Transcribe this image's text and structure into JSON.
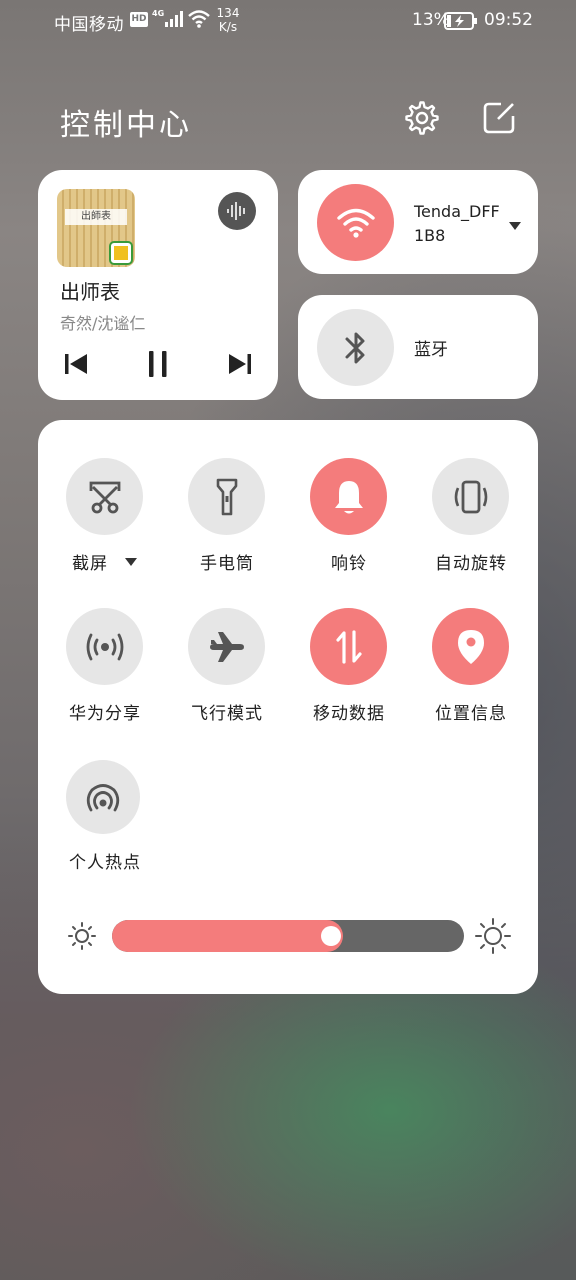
{
  "status_bar": {
    "carrier": "中国移动",
    "hd_badge": "HD",
    "network_type": "4G",
    "net_speed_value": "134",
    "net_speed_unit": "K/s",
    "battery_percent": "13%",
    "time": "09:52"
  },
  "header": {
    "title": "控制中心",
    "settings_icon": "gear-icon",
    "edit_icon": "edit-icon"
  },
  "media": {
    "album_text": "出師表",
    "song_title": "出师表",
    "artist": "奇然/沈谧仁",
    "progress_icon": "audio-wave-icon"
  },
  "wifi": {
    "network_name": "Tenda_DFF1B8",
    "state": "on"
  },
  "bluetooth": {
    "label": "蓝牙",
    "state": "off"
  },
  "toggles": [
    {
      "label": "截屏",
      "icon": "screenshot-icon",
      "state": "off",
      "has_dropdown": true
    },
    {
      "label": "手电筒",
      "icon": "flashlight-icon",
      "state": "off"
    },
    {
      "label": "响铃",
      "icon": "bell-icon",
      "state": "on"
    },
    {
      "label": "自动旋转",
      "icon": "auto-rotate-icon",
      "state": "off"
    },
    {
      "label": "华为分享",
      "icon": "huawei-share-icon",
      "state": "off"
    },
    {
      "label": "飞行模式",
      "icon": "airplane-icon",
      "state": "off"
    },
    {
      "label": "移动数据",
      "icon": "mobile-data-icon",
      "state": "on"
    },
    {
      "label": "位置信息",
      "icon": "location-icon",
      "state": "on"
    },
    {
      "label": "个人热点",
      "icon": "hotspot-icon",
      "state": "off"
    }
  ],
  "brightness": {
    "level": 0.61
  },
  "colors": {
    "accent_on": "#f47c7c",
    "tile_off": "#e6e6e6",
    "icon_dark": "#555555"
  }
}
